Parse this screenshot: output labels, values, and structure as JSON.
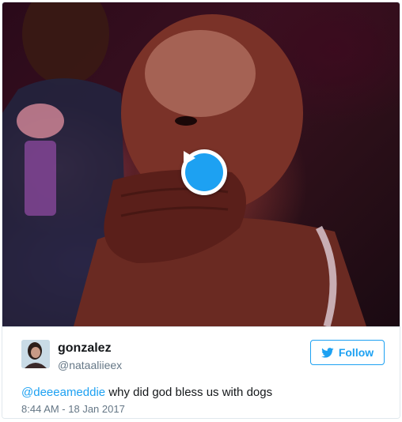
{
  "tweet": {
    "display_name": "gonzalez",
    "handle": "@nataaliieex",
    "follow_label": "Follow",
    "text_mention": "@deeeameddie",
    "text_body": "why did god bless us with dogs",
    "timestamp": "8:44 AM - 18 Jan 2017"
  },
  "media": {
    "type": "video",
    "play_icon": "play-icon"
  },
  "icons": {
    "follow_icon": "twitter-bird-icon"
  },
  "colors": {
    "accent": "#1da1f2",
    "text": "#14171a",
    "muted": "#657786",
    "border": "#e1e8ed"
  }
}
